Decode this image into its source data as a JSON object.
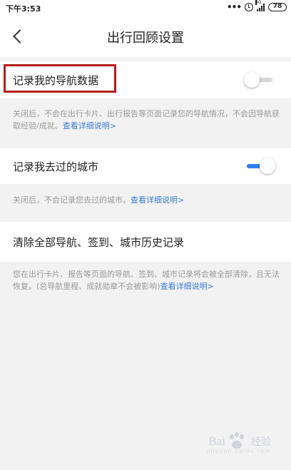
{
  "status_bar": {
    "time": "下午3:53",
    "dots": "•••",
    "network_label": "4G",
    "battery": "78"
  },
  "header": {
    "title": "出行回顾设置",
    "back_icon": "chevron-left-icon"
  },
  "settings": [
    {
      "label": "记录我的导航数据",
      "toggle_on": false,
      "description": "关闭后，不会在出行卡片、出行报告等页面记录您的导航情况，不会因导航获取经验/成就。",
      "link": "查看详细说明>"
    },
    {
      "label": "记录我去过的城市",
      "toggle_on": true,
      "description": "关闭后，不会记录您去过的城市。",
      "link": "查看详细说明>"
    },
    {
      "label": "清除全部导航、签到、城市历史记录",
      "description": "您在出行卡片、报告等页面的导航、签到、城市记录将会被全部清除，且无法恢复。(总导航里程、成就勋章不会被影响)",
      "link": "查看详细说明>"
    }
  ],
  "colors": {
    "highlight": "#b51d1d",
    "toggle_on": "#2f7ef2",
    "link": "#3a7ad6"
  },
  "watermark": {
    "brand": "Bai",
    "brand_suffix": "经验",
    "subtext": "jingyan.baidu.com"
  }
}
